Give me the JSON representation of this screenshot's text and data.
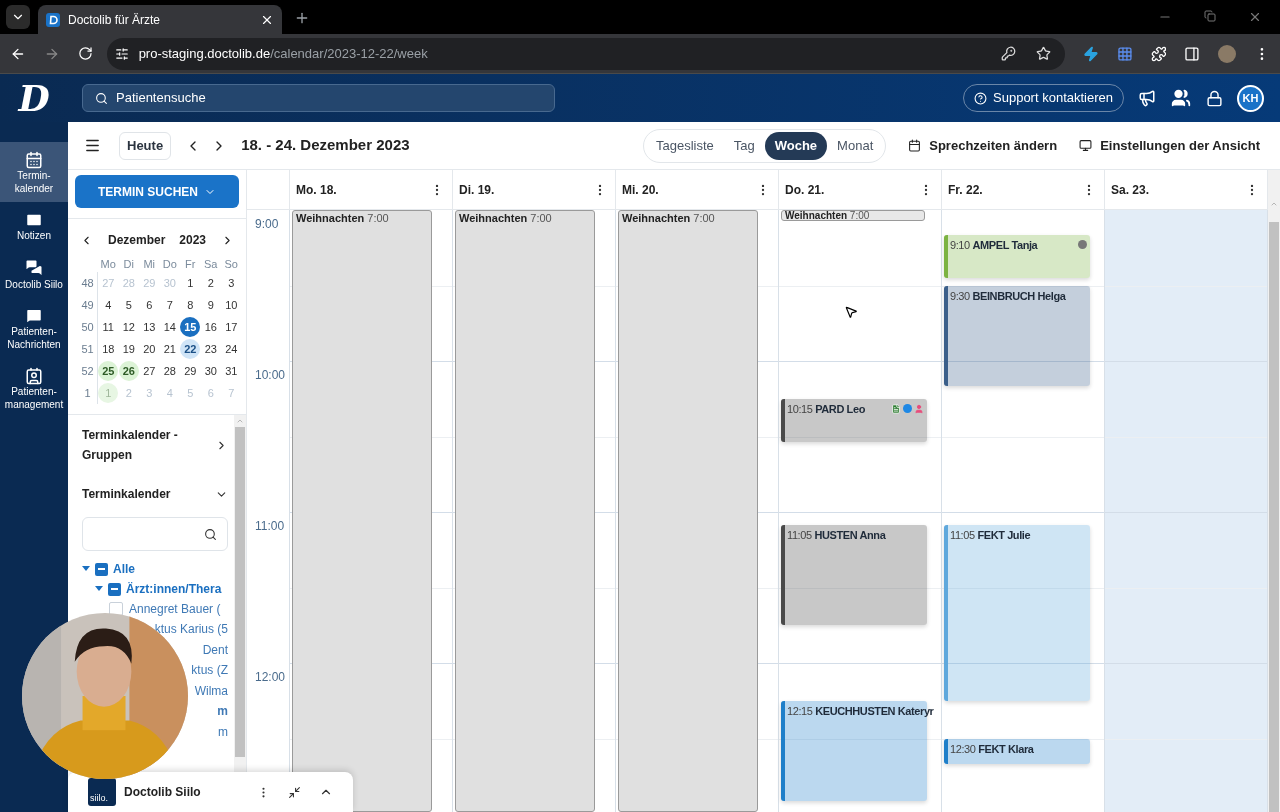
{
  "browser": {
    "tab_title": "Doctolib für Ärzte",
    "url_host": "pro-staging.doctolib.de",
    "url_path": "/calendar/2023-12-22/week"
  },
  "app": {
    "logo": "D",
    "search_placeholder": "Patientensuche",
    "support_button": "Support kontaktieren",
    "avatar": "KH"
  },
  "nav": [
    {
      "label": "Termin-kalender",
      "selected": true,
      "kind": "calendar"
    },
    {
      "label": "Notizen",
      "selected": false,
      "kind": "mail"
    },
    {
      "label": "Doctolib Siilo",
      "selected": false,
      "kind": "chat"
    },
    {
      "label": "Patienten-Nachrichten",
      "selected": false,
      "kind": "message"
    },
    {
      "label": "Patienten-management",
      "selected": false,
      "kind": "badge"
    }
  ],
  "toolbar": {
    "today_button": "Heute",
    "range": "18. - 24. Dezember 2023",
    "views": [
      {
        "label": "Tagesliste",
        "selected": false
      },
      {
        "label": "Tag",
        "selected": false
      },
      {
        "label": "Woche",
        "selected": true
      },
      {
        "label": "Monat",
        "selected": false
      }
    ],
    "actions": [
      {
        "label": "Sprechzeiten ändern",
        "kind": "calendar"
      },
      {
        "label": "Einstellungen der Ansicht",
        "kind": "monitor"
      }
    ]
  },
  "sidebar": {
    "search_button": "TERMIN SUCHEN",
    "mini_calendar": {
      "month": "Dezember",
      "year": "2023",
      "weekdays": [
        "Mo",
        "Di",
        "Mi",
        "Do",
        "Fr",
        "Sa",
        "So"
      ],
      "weeks": [
        {
          "number": "48",
          "days": [
            {
              "label": "27",
              "kind": "other"
            },
            {
              "label": "28",
              "kind": "other"
            },
            {
              "label": "29",
              "kind": "other"
            },
            {
              "label": "30",
              "kind": "other"
            },
            {
              "label": "1",
              "kind": "day"
            },
            {
              "label": "2",
              "kind": "day"
            },
            {
              "label": "3",
              "kind": "day"
            }
          ]
        },
        {
          "number": "49",
          "days": [
            {
              "label": "4",
              "kind": "day"
            },
            {
              "label": "5",
              "kind": "day"
            },
            {
              "label": "6",
              "kind": "day"
            },
            {
              "label": "7",
              "kind": "day"
            },
            {
              "label": "8",
              "kind": "day"
            },
            {
              "label": "9",
              "kind": "day"
            },
            {
              "label": "10",
              "kind": "day"
            }
          ]
        },
        {
          "number": "50",
          "days": [
            {
              "label": "11",
              "kind": "day"
            },
            {
              "label": "12",
              "kind": "day"
            },
            {
              "label": "13",
              "kind": "day"
            },
            {
              "label": "14",
              "kind": "day"
            },
            {
              "label": "15",
              "kind": "today"
            },
            {
              "label": "16",
              "kind": "day"
            },
            {
              "label": "17",
              "kind": "day"
            }
          ]
        },
        {
          "number": "51",
          "days": [
            {
              "label": "18",
              "kind": "day"
            },
            {
              "label": "19",
              "kind": "day"
            },
            {
              "label": "20",
              "kind": "day"
            },
            {
              "label": "21",
              "kind": "day"
            },
            {
              "label": "22",
              "kind": "selected"
            },
            {
              "label": "23",
              "kind": "day"
            },
            {
              "label": "24",
              "kind": "day"
            }
          ]
        },
        {
          "number": "52",
          "days": [
            {
              "label": "25",
              "kind": "holiday"
            },
            {
              "label": "26",
              "kind": "holiday"
            },
            {
              "label": "27",
              "kind": "day"
            },
            {
              "label": "28",
              "kind": "day"
            },
            {
              "label": "29",
              "kind": "day"
            },
            {
              "label": "30",
              "kind": "day"
            },
            {
              "label": "31",
              "kind": "day"
            }
          ]
        },
        {
          "number": "1",
          "days": [
            {
              "label": "1",
              "kind": "other-holiday"
            },
            {
              "label": "2",
              "kind": "other"
            },
            {
              "label": "3",
              "kind": "other"
            },
            {
              "label": "4",
              "kind": "other"
            },
            {
              "label": "5",
              "kind": "other"
            },
            {
              "label": "6",
              "kind": "other"
            },
            {
              "label": "7",
              "kind": "other"
            }
          ]
        }
      ]
    },
    "groups_label": "Terminkalender - Gruppen",
    "calendars_label": "Terminkalender",
    "tree": [
      {
        "label": "Alle",
        "kind": "group",
        "expanded": true,
        "partial": true,
        "children": [
          {
            "label": "Ärzt:innen/Thera",
            "kind": "group",
            "expanded": true,
            "partial": true,
            "children": [
              {
                "label": "Annegret Bauer (",
                "kind": "calendar",
                "checked": false
              },
              {
                "label": "ktus Karius (5",
                "kind": "fragment"
              },
              {
                "label": "Dent",
                "kind": "fragment"
              },
              {
                "label": "ktus (Z",
                "kind": "fragment"
              },
              {
                "label": "Wilma",
                "kind": "fragment"
              }
            ]
          },
          {
            "label": "m",
            "kind": "group-fragment"
          },
          {
            "label": "m",
            "kind": "fragment"
          }
        ]
      }
    ]
  },
  "siilo": {
    "logo": "siilo.",
    "title": "Doctolib Siilo"
  },
  "calendar": {
    "hours": [
      "9:00",
      "10:00",
      "11:00",
      "12:00"
    ],
    "days": [
      {
        "label": "Mo. 18.",
        "closed": false,
        "events": [
          {
            "kind": "allday-block",
            "title": "Weihnachten",
            "time": "7:00"
          }
        ]
      },
      {
        "label": "Di. 19.",
        "closed": false,
        "events": [
          {
            "kind": "allday-block",
            "title": "Weihnachten",
            "time": "7:00"
          }
        ]
      },
      {
        "label": "Mi. 20.",
        "closed": false,
        "events": [
          {
            "kind": "allday-block",
            "title": "Weihnachten",
            "time": "7:00"
          }
        ]
      },
      {
        "label": "Do. 21.",
        "closed": false,
        "events": [
          {
            "kind": "allday-bar",
            "title": "Weihnachten",
            "time": "7:00"
          },
          {
            "kind": "appointment-short",
            "time": "10:15",
            "title": "PARD Leo",
            "color": "#4a4a4a",
            "icons": [
              {
                "kind": "file"
              },
              {
                "kind": "circle"
              },
              {
                "kind": "person"
              }
            ]
          },
          {
            "kind": "appointment-medium",
            "time": "11:05",
            "title": "HUSTEN Anna",
            "color": "#4a4a4a"
          },
          {
            "kind": "appointment-medium",
            "time": "12:15",
            "title": "KEUCHHUSTEN Kateryr",
            "color": "#1f7fc9"
          }
        ]
      },
      {
        "label": "Fr. 22.",
        "closed": false,
        "events": [
          {
            "kind": "appointment-short",
            "time": "9:10",
            "title": "AMPEL Tanja",
            "color": "#7cb342",
            "icons": [
              {
                "kind": "gray-circle"
              }
            ]
          },
          {
            "kind": "appointment-medium",
            "time": "9:30",
            "title": "BEINBRUCH Helga",
            "color": "#3b5f8a"
          },
          {
            "kind": "appointment-long",
            "time": "11:05",
            "title": "FEKT Julie",
            "color": "#5fa8dc"
          },
          {
            "kind": "appointment-tiny",
            "time": "12:30",
            "title": "FEKT Klara",
            "color": "#1f7fc9"
          }
        ]
      },
      {
        "label": "Sa. 23.",
        "closed": true
      }
    ]
  }
}
